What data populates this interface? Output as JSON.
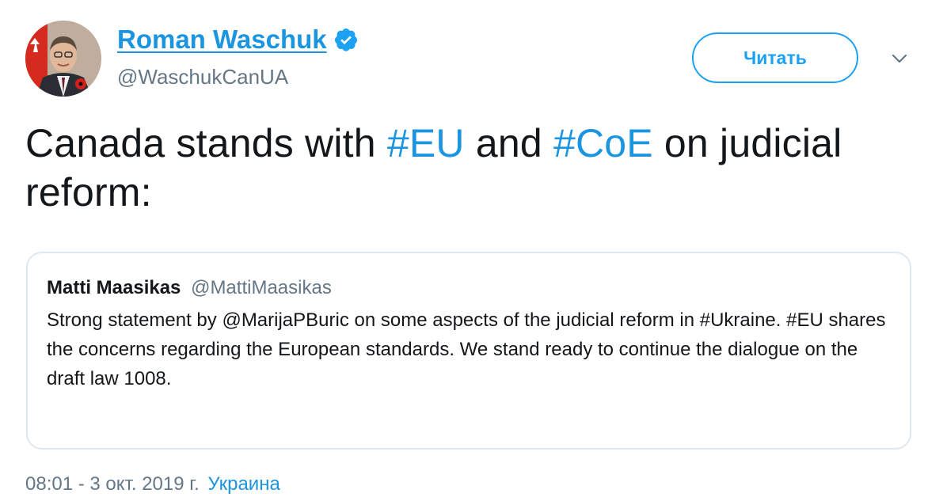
{
  "author": {
    "display_name": "Roman Waschuk",
    "handle": "@WaschukCanUA",
    "verified": true
  },
  "follow_button": {
    "label": "Читать"
  },
  "icons": {
    "verified": "verified-badge-icon",
    "menu": "chevron-down-icon"
  },
  "tweet": {
    "text_parts": [
      "Canada stands with ",
      "#EU",
      " and ",
      "#CoE",
      " on judicial reform:"
    ]
  },
  "quoted_tweet": {
    "author_name": "Matti Maasikas",
    "author_handle": "@MattiMaasikas",
    "text": "Strong statement by @MarijaPBuric on some aspects of the judicial reform in #Ukraine. #EU shares the concerns regarding the European standards. We stand ready to continue the dialogue on the draft law 1008."
  },
  "meta": {
    "timestamp": "08:01 - 3 окт. 2019 г.",
    "location": "Украина"
  },
  "colors": {
    "accent": "#1da1f2",
    "link": "#1b95e0",
    "text": "#14171a",
    "secondary": "#657786",
    "border": "#e1e8ed"
  }
}
